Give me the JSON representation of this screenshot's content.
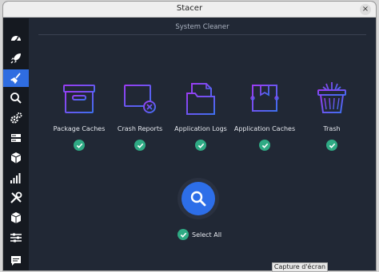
{
  "window": {
    "title": "Stacer",
    "close_glyph": "×"
  },
  "sidebar": {
    "items": [
      {
        "name": "dashboard-icon",
        "active": false
      },
      {
        "name": "rocket-icon",
        "active": false
      },
      {
        "name": "broom-icon",
        "active": true
      },
      {
        "name": "search-icon",
        "active": false
      },
      {
        "name": "gears-icon",
        "active": false
      },
      {
        "name": "server-icon",
        "active": false
      },
      {
        "name": "box-icon",
        "active": false
      },
      {
        "name": "chart-bars-icon",
        "active": false
      },
      {
        "name": "tools-icon",
        "active": false
      },
      {
        "name": "cube-icon",
        "active": false
      },
      {
        "name": "sliders-icon",
        "active": false
      },
      {
        "name": "chat-icon",
        "active": false
      }
    ]
  },
  "main": {
    "section_title": "System Cleaner",
    "categories": [
      {
        "label": "Package Caches",
        "checked": true,
        "icon": "package-caches-icon"
      },
      {
        "label": "Crash Reports",
        "checked": true,
        "icon": "crash-reports-icon"
      },
      {
        "label": "Application Logs",
        "checked": true,
        "icon": "application-logs-icon"
      },
      {
        "label": "Application Caches",
        "checked": true,
        "icon": "application-caches-icon"
      },
      {
        "label": "Trash",
        "checked": true,
        "icon": "trash-icon"
      }
    ],
    "select_all_label": "Select All",
    "select_all_checked": true
  },
  "tooltip": {
    "text": "Capture d'écran"
  },
  "colors": {
    "accent": "#2d6ee8",
    "check": "#2faa84",
    "icon_gradient_start": "#8a3cf0",
    "icon_gradient_end": "#3f6ff0",
    "background": "#212835",
    "sidebar": "#151920"
  }
}
